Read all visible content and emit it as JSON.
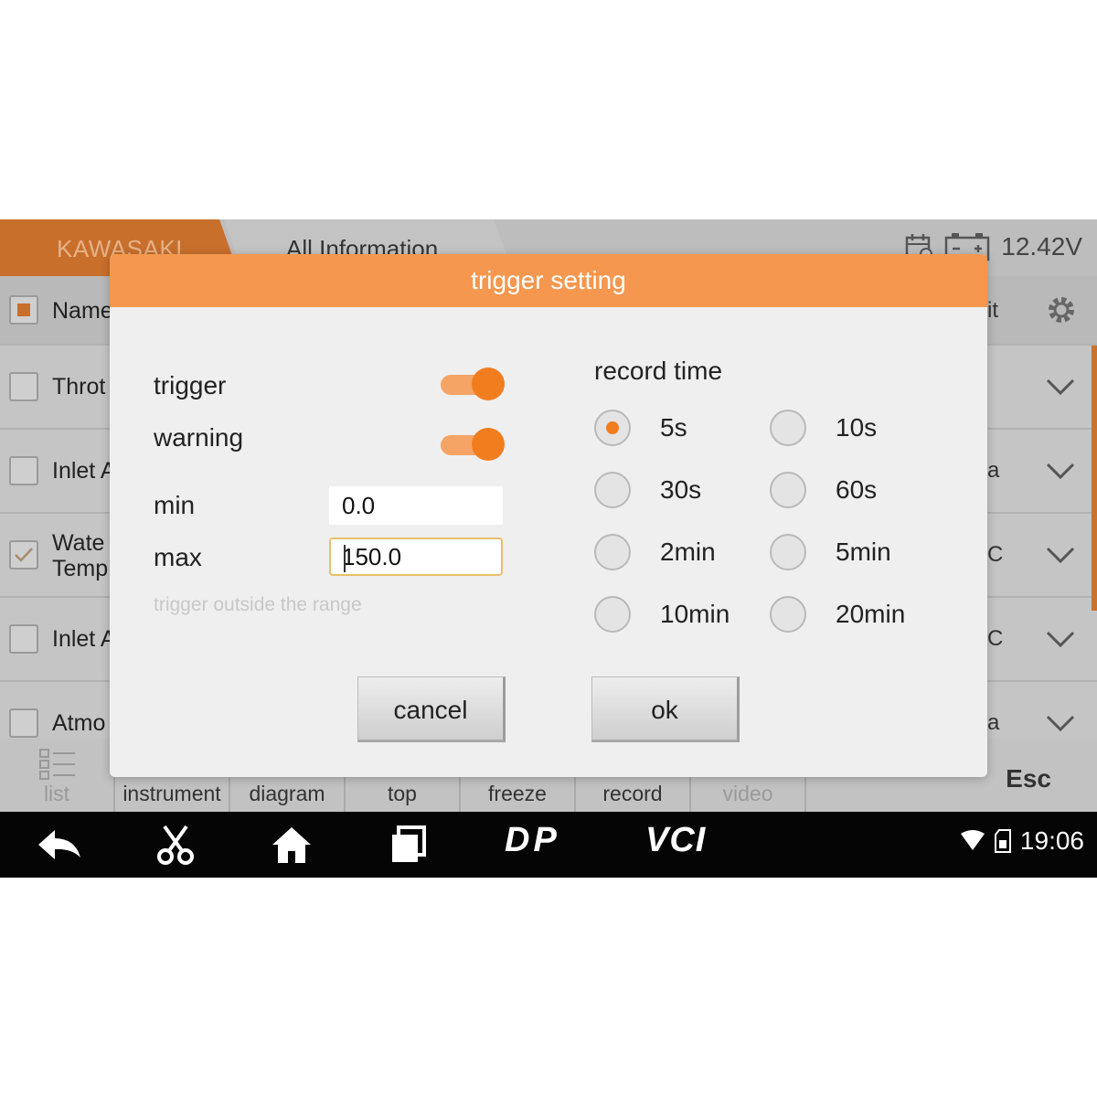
{
  "topbar": {
    "brand": "KAWASAKI",
    "section": "All Information",
    "voltage": "12.42V"
  },
  "list": {
    "header": {
      "name": "Name",
      "unit": "it"
    },
    "rows": [
      {
        "name": "Throt",
        "unit": "",
        "checked": false
      },
      {
        "name": "Inlet A",
        "unit": "a",
        "checked": false
      },
      {
        "name": "Wate\nTemp",
        "unit": "C",
        "checked": true
      },
      {
        "name": "Inlet A",
        "unit": "C",
        "checked": false
      },
      {
        "name": "Atmo",
        "unit": "a",
        "checked": false
      }
    ]
  },
  "tabs": {
    "list": "list",
    "instrument": "instrument",
    "diagram": "diagram",
    "top": "top",
    "freeze": "freeze",
    "record": "record",
    "video": "video",
    "esc": "Esc"
  },
  "navbar": {
    "dp": "DP",
    "vci": "VCI",
    "time": "19:06"
  },
  "dialog": {
    "title": "trigger setting",
    "trigger_label": "trigger",
    "trigger_on": true,
    "warning_label": "warning",
    "warning_on": true,
    "min_label": "min",
    "min_value": "0.0",
    "max_label": "max",
    "max_value": "150.0",
    "hint": "trigger outside the range",
    "record_time_label": "record time",
    "record_options": [
      "5s",
      "10s",
      "30s",
      "60s",
      "2min",
      "5min",
      "10min",
      "20min"
    ],
    "record_selected": "5s",
    "cancel_label": "cancel",
    "ok_label": "ok"
  },
  "colors": {
    "accent": "#f27d1f",
    "dialog_title_bg": "#f5974e",
    "brand_tab": "#c96f2c"
  }
}
